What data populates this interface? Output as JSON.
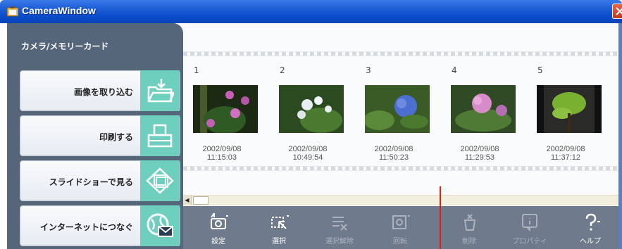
{
  "window": {
    "title": "CameraWindow"
  },
  "sidebar": {
    "header": "カメラ/メモリーカード",
    "items": [
      {
        "label": "画像を取り込む",
        "icon": "folder-import-icon"
      },
      {
        "label": "印刷する",
        "icon": "print-icon"
      },
      {
        "label": "スライドショーで見る",
        "icon": "slideshow-icon"
      },
      {
        "label": "インターネットにつなぐ",
        "icon": "internet-mail-icon"
      }
    ]
  },
  "thumbnails": [
    {
      "num": "1",
      "date": "2002/09/08",
      "time": "11:15:03"
    },
    {
      "num": "2",
      "date": "2002/09/08",
      "time": "10:49:54"
    },
    {
      "num": "3",
      "date": "2002/09/08",
      "time": "11:50:23"
    },
    {
      "num": "4",
      "date": "2002/09/08",
      "time": "11:29:53"
    },
    {
      "num": "5",
      "date": "2002/09/08",
      "time": "11:37:12"
    }
  ],
  "toolbar": {
    "settings": "設定",
    "select": "選択",
    "deselect": "選択解除",
    "rotate": "回転",
    "delete": "削除",
    "properties": "プロパティ",
    "help": "ヘルプ"
  },
  "colors": {
    "titlebar": "#0a4ccc",
    "sidebar_bg": "#55657a",
    "icon_tile": "#6fcfbf",
    "toolbar_bg": "#6f7b8c"
  }
}
